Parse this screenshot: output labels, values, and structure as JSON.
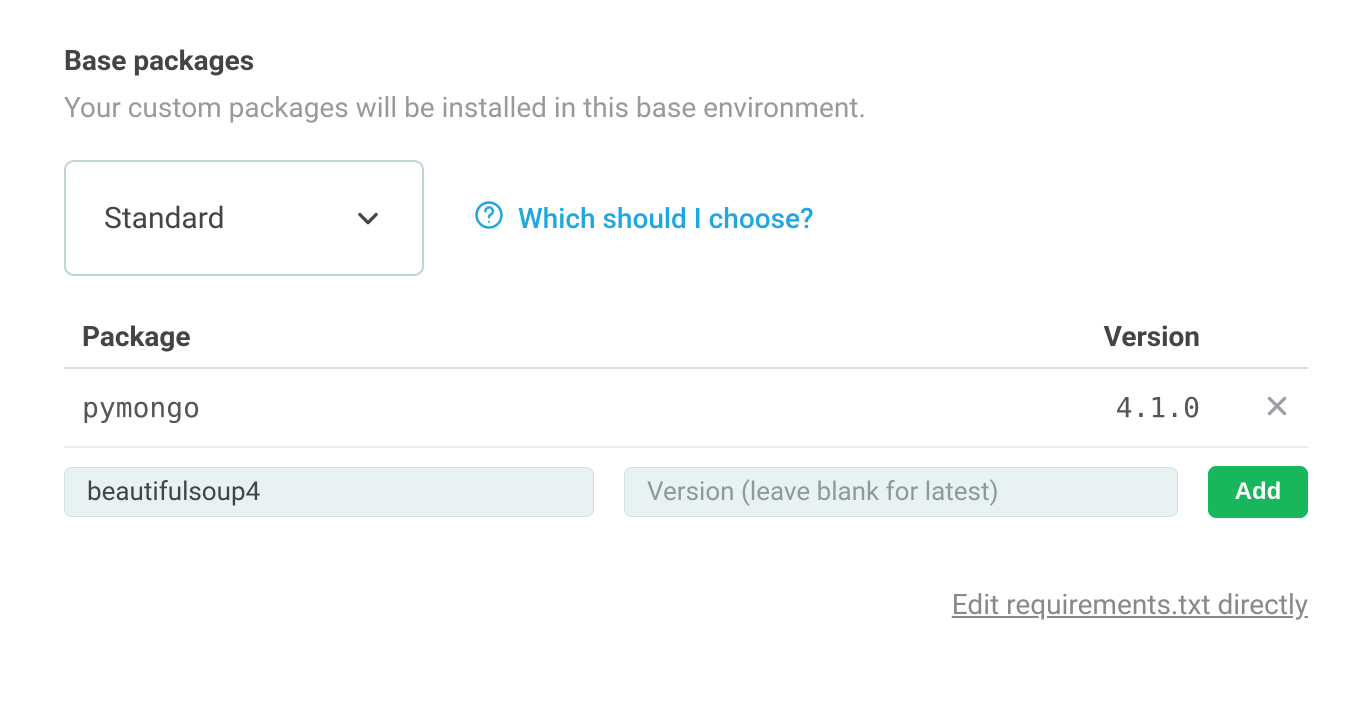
{
  "section": {
    "title": "Base packages",
    "subtitle": "Your custom packages will be installed in this base environment."
  },
  "base_select": {
    "value": "Standard"
  },
  "help_link": "Which should I choose?",
  "table": {
    "headers": {
      "package": "Package",
      "version": "Version"
    },
    "rows": [
      {
        "name": "pymongo",
        "version": "4.1.0"
      }
    ]
  },
  "add_form": {
    "package_value": "beautifulsoup4",
    "package_placeholder": "",
    "version_value": "",
    "version_placeholder": "Version (leave blank for latest)",
    "add_label": "Add"
  },
  "footer_link": "Edit requirements.txt directly"
}
